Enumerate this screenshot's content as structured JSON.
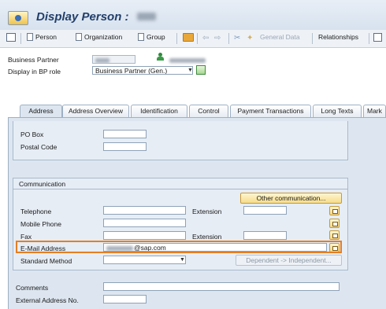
{
  "window": {
    "title": "Display Person :"
  },
  "toolbar": {
    "person": "Person",
    "organization": "Organization",
    "group": "Group",
    "general_data": "General Data",
    "relationships": "Relationships"
  },
  "header": {
    "business_partner_label": "Business Partner",
    "display_role_label": "Display in BP role",
    "bp_role_value": "Business Partner (Gen.)"
  },
  "tabs": [
    "Address",
    "Address Overview",
    "Identification",
    "Control",
    "Payment Transactions",
    "Long Texts",
    "Mark"
  ],
  "address": {
    "po_box_label": "PO Box",
    "postal_code_label": "Postal Code"
  },
  "communication": {
    "section_title": "Communication",
    "other_comm_button": "Other communication...",
    "telephone_label": "Telephone",
    "extension_label": "Extension",
    "mobile_label": "Mobile Phone",
    "fax_label": "Fax",
    "fax_extension_label": "Extension",
    "email_label": "E-Mail Address",
    "email_value": "@sap.com",
    "standard_method_label": "Standard Method",
    "dependent_button": "Dependent -> Independent..."
  },
  "footer_fields": {
    "comments_label": "Comments",
    "external_address_label": "External Address No."
  },
  "colors": {
    "highlight": "#e67e22",
    "title": "#223f6a"
  }
}
